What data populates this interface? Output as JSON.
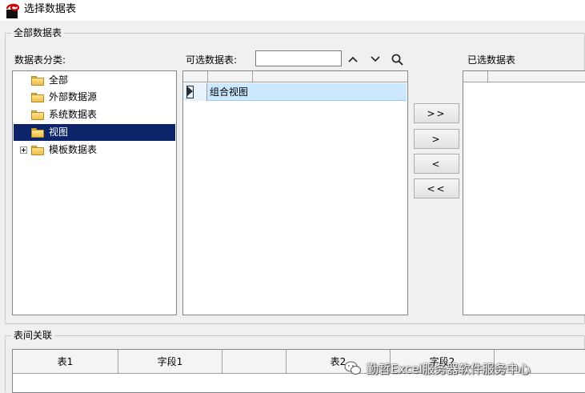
{
  "window": {
    "title": "选择数据表"
  },
  "all_tables_group": {
    "label": "全部数据表"
  },
  "categories": {
    "label": "数据表分类:",
    "items": [
      {
        "label": "全部",
        "selected": false,
        "expandable": false
      },
      {
        "label": "外部数据源",
        "selected": false,
        "expandable": false
      },
      {
        "label": "系统数据表",
        "selected": false,
        "expandable": false
      },
      {
        "label": "视图",
        "selected": true,
        "expandable": false
      },
      {
        "label": "模板数据表",
        "selected": false,
        "expandable": true
      }
    ]
  },
  "available": {
    "label": "可选数据表:",
    "search_value": "",
    "rows": [
      {
        "name": "组合视图",
        "selected": true
      }
    ]
  },
  "toolbar": {
    "icons": [
      "chevron-up-icon",
      "chevron-down-icon",
      "search-icon"
    ]
  },
  "move_buttons": {
    "add_all": ">>",
    "add": ">",
    "remove": "<",
    "remove_all": "<<"
  },
  "selected_tables": {
    "label": "已选数据表"
  },
  "relations": {
    "label": "表间关联",
    "columns": [
      "表1",
      "字段1",
      "",
      "表2",
      "字段2",
      ""
    ]
  },
  "watermark": {
    "text": "勤哲Excel服务器软件服务中心"
  },
  "colors": {
    "selection_dark": "#0b246a",
    "selection_light": "#cce8ff",
    "window_bg": "#f0f0f0"
  }
}
